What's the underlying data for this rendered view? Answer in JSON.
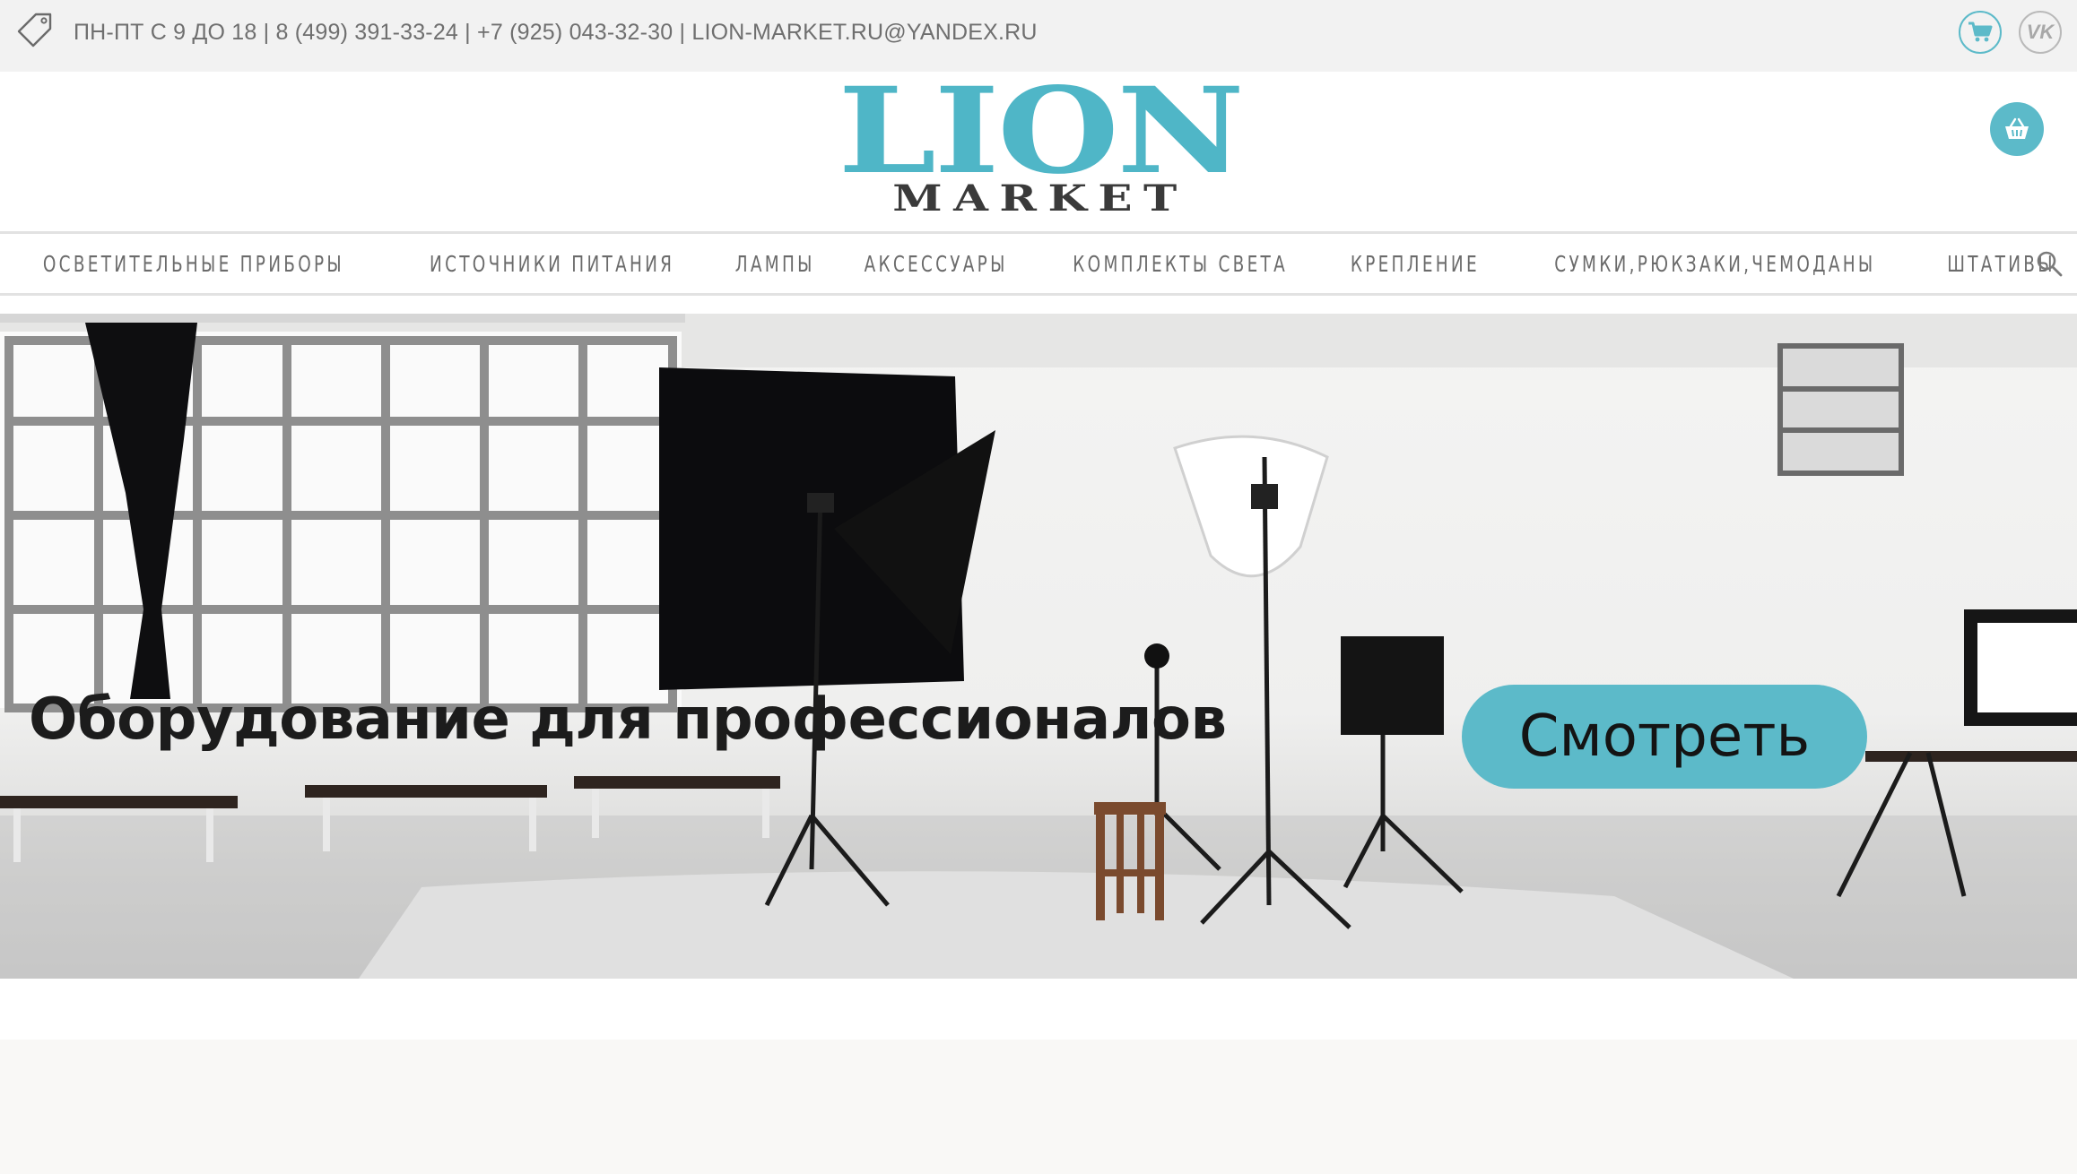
{
  "topbar": {
    "contacts": "ПН-ПТ С 9 ДО 18 | 8 (499) 391-33-24 | +7 (925) 043-32-30 | LION-MARKET.RU@YANDEX.RU",
    "icons": [
      "tag-icon",
      "cart-icon",
      "vk-icon"
    ],
    "vk_label": "VK"
  },
  "header": {
    "logo_top": "LION",
    "logo_bottom": "MARKET",
    "basket_icon": "basket-icon"
  },
  "nav": {
    "items": [
      {
        "label": "ОСВЕТИТЕЛЬНЫЕ ПРИБОРЫ"
      },
      {
        "label": "ИСТОЧНИКИ ПИТАНИЯ"
      },
      {
        "label": "ЛАМПЫ"
      },
      {
        "label": "АКСЕССУАРЫ"
      },
      {
        "label": "КОМПЛЕКТЫ СВЕТА"
      },
      {
        "label": "КРЕПЛЕНИЕ"
      },
      {
        "label": "СУМКИ,РЮКЗАКИ,ЧЕМОДАНЫ"
      },
      {
        "label": "ШТАТИВЫ"
      }
    ],
    "search_icon": "search-icon"
  },
  "hero": {
    "title": "Оборудование для профессионалов",
    "button_label": "Смотреть",
    "slide_progress": 0.33
  },
  "colors": {
    "accent": "#5cbac9",
    "topbar_bg": "#f2f2f2",
    "text_muted": "#6f6f6f",
    "logo_dark": "#3a3a3a"
  }
}
